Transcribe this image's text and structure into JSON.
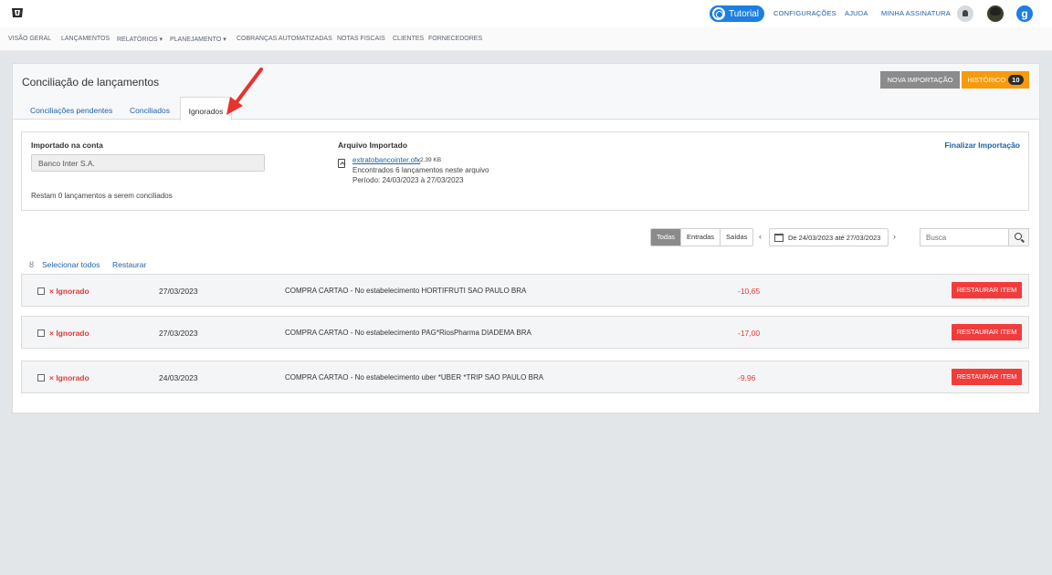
{
  "topbar": {
    "tutorial_label": "Tutorial",
    "links": [
      "CONFIGURAÇÕES",
      "AJUDA",
      "MINHA ASSINATURA"
    ],
    "brand_letter": "g"
  },
  "nav": {
    "items": [
      "VISÃO GERAL",
      "LANÇAMENTOS",
      "RELATÓRIOS ▾",
      "PLANEJAMENTO ▾",
      "COBRANÇAS AUTOMATIZADAS",
      "NOTAS FISCAIS",
      "CLIENTES",
      "FORNECEDORES"
    ]
  },
  "page": {
    "title": "Conciliação de lançamentos",
    "new_import_label": "NOVA IMPORTAÇÃO",
    "history_label": "HISTÓRICO",
    "history_count": "10",
    "tabs": [
      "Conciliações pendentes",
      "Conciliados",
      "Ignorados"
    ]
  },
  "info": {
    "account_label": "Importado na conta",
    "account_value": "Banco Inter S.A.",
    "file_label": "Arquivo Importado",
    "file_name": "extratobancointer.ofx",
    "file_size": "- 2.39 KB",
    "found_text": "Encontrados 6 lançamentos neste arquivo",
    "period_text": "Período: 24/03/2023 à 27/03/2023",
    "finalize_label": "Finalizar Importação",
    "remaining_text": "Restam 0 lançamentos a serem conciliados"
  },
  "filters": {
    "segments": [
      "Todas",
      "Entradas",
      "Saídas"
    ],
    "date_range": "De 24/03/2023 até 27/03/2023",
    "search_placeholder": "Busca"
  },
  "actions": {
    "select_all": "Selecionar todos",
    "restore": "Restaurar"
  },
  "transactions": [
    {
      "status": "× Ignorado",
      "date": "27/03/2023",
      "description": "COMPRA CARTAO - No estabelecimento HORTIFRUTI SAO PAULO BRA",
      "amount": "-10,65",
      "action": "RESTAURAR ITEM"
    },
    {
      "status": "× Ignorado",
      "date": "27/03/2023",
      "description": "COMPRA CARTAO - No estabelecimento PAG*RiosPharma DIADEMA BRA",
      "amount": "-17,00",
      "action": "RESTAURAR ITEM"
    },
    {
      "status": "× Ignorado",
      "date": "24/03/2023",
      "description": "COMPRA CARTAO - No estabelecimento uber *UBER *TRIP SAO PAULO BRA",
      "amount": "-9,96",
      "action": "RESTAURAR ITEM"
    }
  ],
  "colors": {
    "accent_blue": "#1d7fe0",
    "history_orange": "#f99a0c",
    "restore_red": "#f23c3c",
    "annotation_red": "#e8322f"
  }
}
